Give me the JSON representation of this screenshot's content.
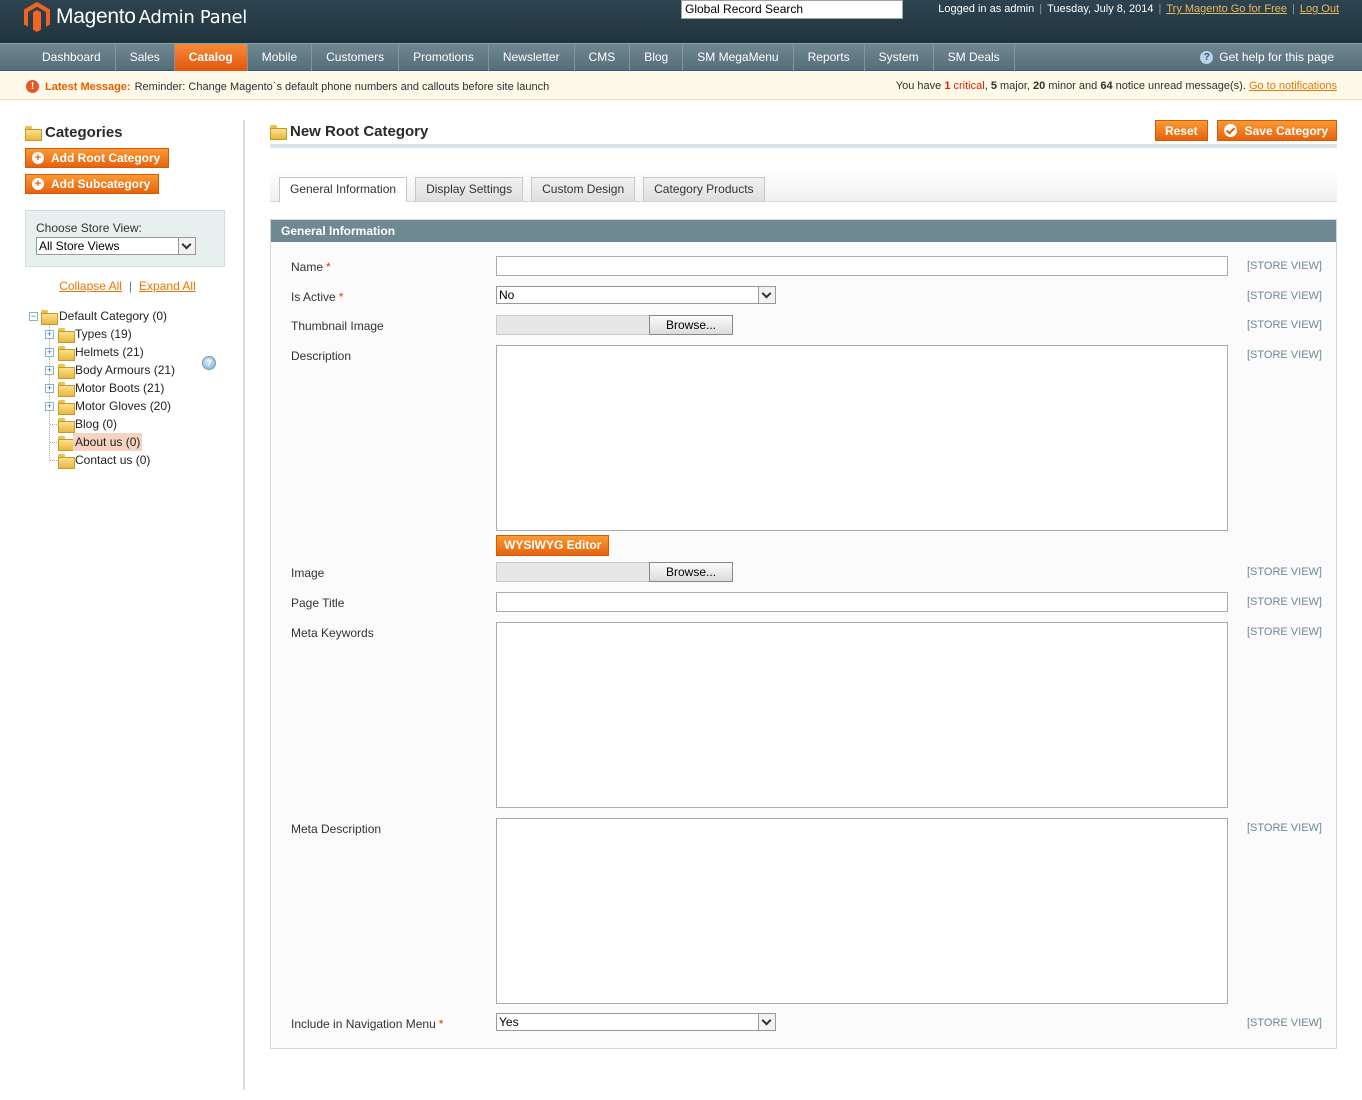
{
  "header": {
    "logo_brand": "Magento",
    "logo_sub": "Admin Panel",
    "search_value": "Global Record Search",
    "logged_in": "Logged in as admin",
    "date": "Tuesday, July 8, 2014",
    "try_link": "Try Magento Go for Free",
    "logout_link": "Log Out"
  },
  "nav": {
    "items": [
      "Dashboard",
      "Sales",
      "Catalog",
      "Mobile",
      "Customers",
      "Promotions",
      "Newsletter",
      "CMS",
      "Blog",
      "SM MegaMenu",
      "Reports",
      "System",
      "SM Deals"
    ],
    "active": "Catalog",
    "help": "Get help for this page"
  },
  "notice": {
    "label": "Latest Message:",
    "text": "Reminder: Change Magento`s default phone numbers and callouts before site launch",
    "summary_prefix": "You have",
    "critical_count": "1",
    "critical_label": "critical",
    "major_count": "5",
    "major_label": "major,",
    "minor_count": "20",
    "minor_label": "minor and",
    "notice_count": "64",
    "notice_label": "notice unread message(s).",
    "link": "Go to notifications"
  },
  "sidebar": {
    "title": "Categories",
    "add_root": "Add Root Category",
    "add_sub": "Add Subcategory",
    "store_label": "Choose Store View:",
    "store_value": "All Store Views",
    "collapse_all": "Collapse All",
    "expand_all": "Expand All",
    "sep": "|",
    "tree": {
      "root": "Default Category (0)",
      "children": [
        {
          "label": "Types (19)",
          "expandable": true
        },
        {
          "label": "Helmets (21)",
          "expandable": true
        },
        {
          "label": "Body Armours (21)",
          "expandable": true
        },
        {
          "label": "Motor Boots (21)",
          "expandable": true
        },
        {
          "label": "Motor Gloves (20)",
          "expandable": true
        },
        {
          "label": "Blog (0)",
          "expandable": false
        },
        {
          "label": "About us (0)",
          "expandable": false,
          "selected": true
        },
        {
          "label": "Contact us (0)",
          "expandable": false
        }
      ]
    }
  },
  "main": {
    "title": "New Root Category",
    "reset": "Reset",
    "save": "Save Category",
    "tabs": [
      "General Information",
      "Display Settings",
      "Custom Design",
      "Category Products"
    ],
    "active_tab": "General Information",
    "section_title": "General Information",
    "scope_label": "[STORE VIEW]",
    "browse": "Browse...",
    "wysiwyg": "WYSIWYG Editor",
    "fields": {
      "name": "Name",
      "is_active": "Is Active",
      "is_active_value": "No",
      "thumbnail": "Thumbnail Image",
      "description": "Description",
      "image": "Image",
      "page_title": "Page Title",
      "meta_keywords": "Meta Keywords",
      "meta_description": "Meta Description",
      "include_nav": "Include in Navigation Menu",
      "include_nav_value": "Yes"
    }
  },
  "colors": {
    "accent": "#f26d1a",
    "header_bg": "#2d4450",
    "nav_bg": "#627c86",
    "section_head": "#6f8992"
  }
}
